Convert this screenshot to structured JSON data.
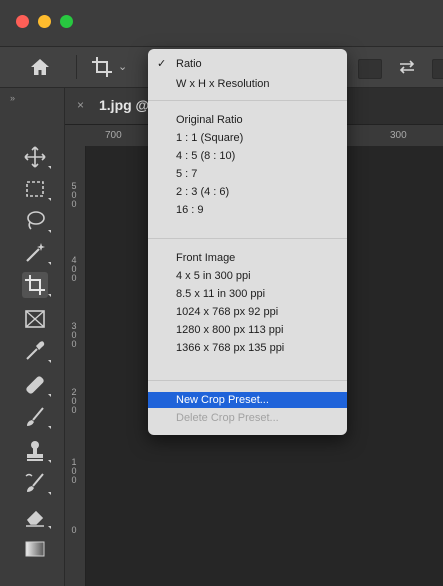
{
  "document": {
    "tab_close": "×",
    "tab_title": "1.jpg @"
  },
  "ruler": {
    "h_labels": [
      "700",
      "300"
    ],
    "v_labels": [
      "5\n0\n0",
      "4\n0\n0",
      "3\n0\n0",
      "2\n0\n0",
      "1\n0\n0",
      "0"
    ]
  },
  "toolbar": {
    "collapse": "»"
  },
  "options_bar": {
    "chevron": "⌄"
  },
  "menu": {
    "check": "✓",
    "items": [
      {
        "label": "Ratio",
        "checked": true,
        "state": "normal"
      },
      {
        "label": "W x H x Resolution",
        "state": "normal"
      },
      {
        "label": "Original Ratio",
        "state": "normal"
      },
      {
        "label": "1 : 1 (Square)",
        "state": "normal"
      },
      {
        "label": "4 : 5 (8 : 10)",
        "state": "normal"
      },
      {
        "label": "5 : 7",
        "state": "normal"
      },
      {
        "label": "2 : 3 (4 : 6)",
        "state": "normal"
      },
      {
        "label": "16 : 9",
        "state": "normal"
      },
      {
        "label": "Front Image",
        "state": "normal"
      },
      {
        "label": "4 x 5 in 300 ppi",
        "state": "normal"
      },
      {
        "label": "8.5 x 11 in 300 ppi",
        "state": "normal"
      },
      {
        "label": "1024 x 768 px 92 ppi",
        "state": "normal"
      },
      {
        "label": "1280 x 800 px 113 ppi",
        "state": "normal"
      },
      {
        "label": "1366 x 768 px 135 ppi",
        "state": "normal"
      },
      {
        "label": "New Crop Preset...",
        "state": "selected"
      },
      {
        "label": "Delete Crop Preset...",
        "state": "disabled"
      }
    ]
  },
  "colors": {
    "menu_highlight": "#1f63d9",
    "menu_bg": "#dedede",
    "chrome": "#3c3c3c"
  },
  "icons": [
    "home-icon",
    "crop-tool-icon",
    "swap-icon",
    "move-icon",
    "marquee-icon",
    "lasso-icon",
    "magic-wand-icon",
    "crop-icon",
    "frame-icon",
    "eyedropper-icon",
    "healing-brush-icon",
    "brush-icon",
    "clone-stamp-icon",
    "history-brush-icon",
    "eraser-icon",
    "gradient-icon"
  ]
}
